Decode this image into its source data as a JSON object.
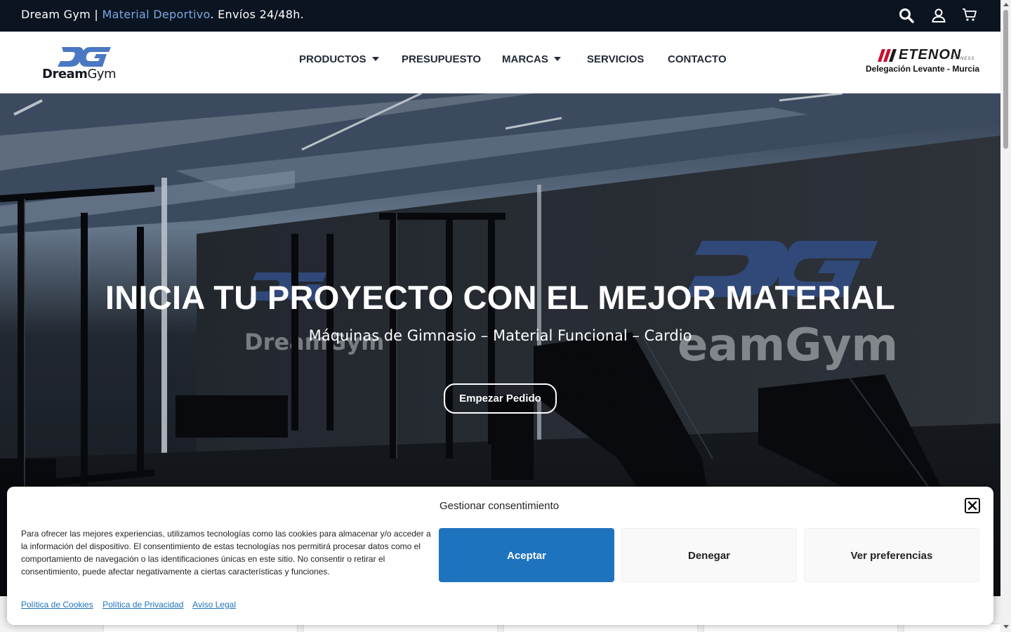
{
  "topbar": {
    "brand": "Dream Gym",
    "separator": " | ",
    "highlight": "Material Deportivo",
    "rest": ". Envíos 24/48h.",
    "icons": [
      "search-icon",
      "user-icon",
      "cart-icon"
    ]
  },
  "header": {
    "logo_mark": "DG",
    "logo_text_bold": "Dream",
    "logo_text_light": "Gym",
    "nav": [
      {
        "label": "PRODUCTOS",
        "has_dropdown": true
      },
      {
        "label": "PRESUPUESTO",
        "has_dropdown": false
      },
      {
        "label": "MARCAS",
        "has_dropdown": true
      },
      {
        "label": "SERVICIOS",
        "has_dropdown": false
      },
      {
        "label": "CONTACTO",
        "has_dropdown": false
      }
    ],
    "partner": {
      "name": "ETENON",
      "sub": "FITNESS",
      "caption": "Delegación Levante - Murcia"
    }
  },
  "hero": {
    "title": "INICIA TU PROYECTO CON EL MEJOR MATERIAL",
    "subtitle": "Máquinas de Gimnasio – Material Funcional – Cardio",
    "button": "Empezar Pedido"
  },
  "cookie": {
    "title": "Gestionar consentimiento",
    "text": "Para ofrecer las mejores experiencias, utilizamos tecnologías como las cookies para almacenar y/o acceder a la información del dispositivo. El consentimiento de estas tecnologías nos permitirá procesar datos como el comportamiento de navegación o las identificaciones únicas en este sitio. No consentir o retirar el consentimiento, puede afectar negativamente a ciertas características y funciones.",
    "accept": "Aceptar",
    "deny": "Denegar",
    "preferences": "Ver preferencias",
    "links": [
      "Política de Cookies",
      "Política de Privacidad",
      "Aviso Legal"
    ]
  },
  "colors": {
    "topbar_bg": "#0b1522",
    "accent": "#7ea7e0",
    "primary_button": "#1e73be",
    "logo_blue": "#4a78c2"
  }
}
